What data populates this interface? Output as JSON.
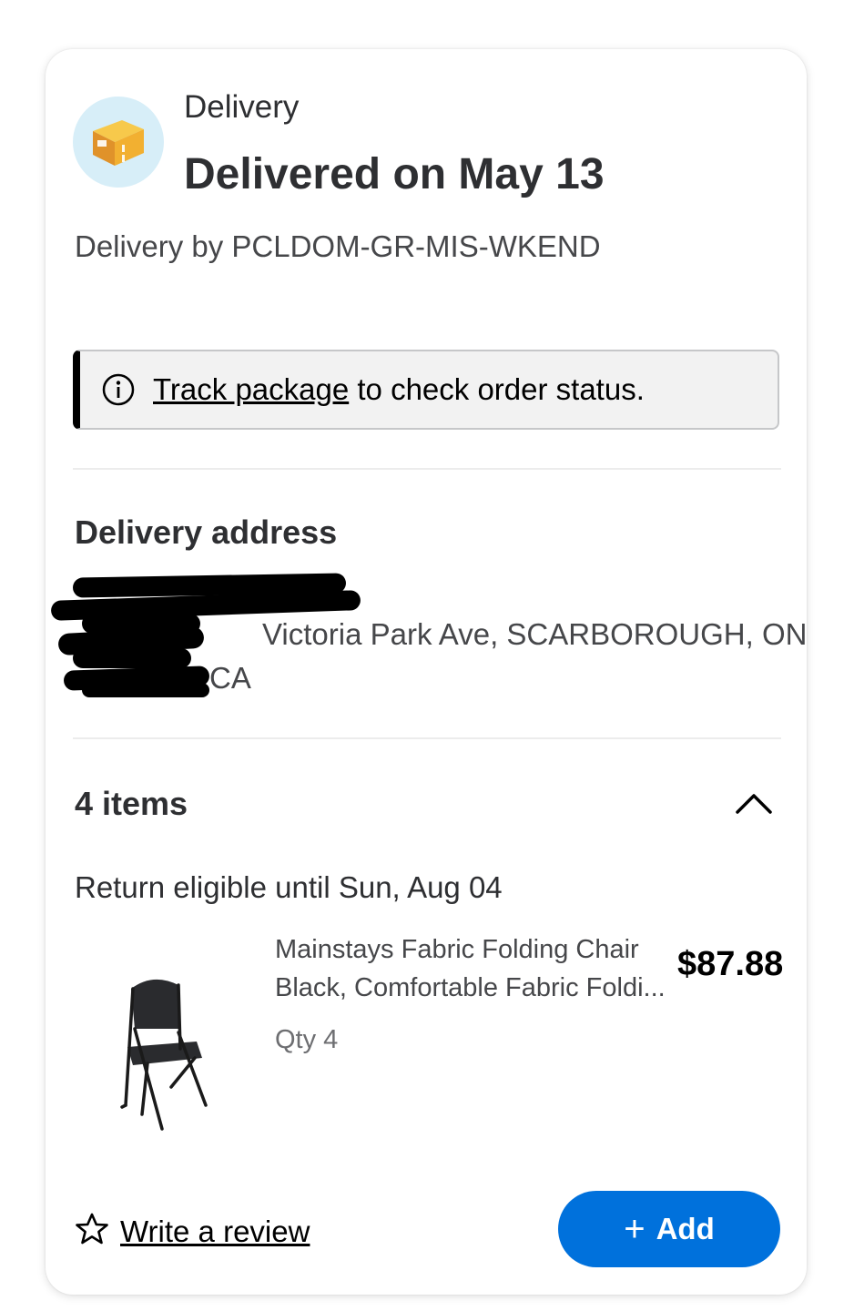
{
  "delivery": {
    "label": "Delivery",
    "status": "Delivered on May 13",
    "carrier": "Delivery by PCLDOM-GR-MIS-WKEND",
    "icon": "package-box-icon"
  },
  "alert": {
    "link_text": "Track package",
    "text": " to check order status.",
    "icon": "info-icon"
  },
  "address": {
    "title": "Delivery address",
    "line2": "Victoria Park Ave, SCARBOROUGH, ON",
    "line3": "CA"
  },
  "items": {
    "count_label": "4 items",
    "return_text": "Return eligible until Sun, Aug 04",
    "product": {
      "name_line1": "Mainstays Fabric Folding Chair",
      "name_line2": "Black, Comfortable Fabric Foldi...",
      "price": "$87.88",
      "qty": "Qty 4"
    }
  },
  "actions": {
    "review_label": "Write a review",
    "add_label": "Add",
    "add_plus": "+"
  },
  "colors": {
    "accent": "#0071dc",
    "icon_bg": "#d7eef8"
  }
}
